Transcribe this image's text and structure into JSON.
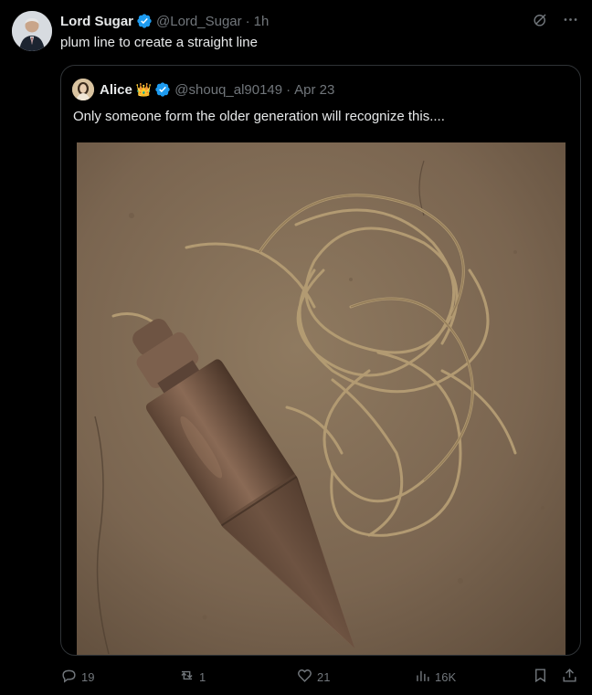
{
  "tweet": {
    "author_name": "Lord Sugar",
    "author_handle": "@Lord_Sugar",
    "separator": "·",
    "time": "1h",
    "text": "plum line to create a straight line",
    "icons": [
      "grok-icon",
      "more-icon"
    ]
  },
  "quote": {
    "author_name": "Alice",
    "author_badge": "👑",
    "author_handle": "@shouq_al90149",
    "separator": "·",
    "date": "Apr 23",
    "text": "Only someone form the older generation will recognize this....",
    "media": "photo of a plumb bob with string on a stone surface"
  },
  "actions": {
    "replies": "19",
    "reposts": "1",
    "likes": "21",
    "views": "16K"
  },
  "colors": {
    "background": "#000000",
    "text": "#e7e9ea",
    "muted": "#71767b",
    "verified": "#1d9bf0",
    "border": "#2f3336"
  }
}
